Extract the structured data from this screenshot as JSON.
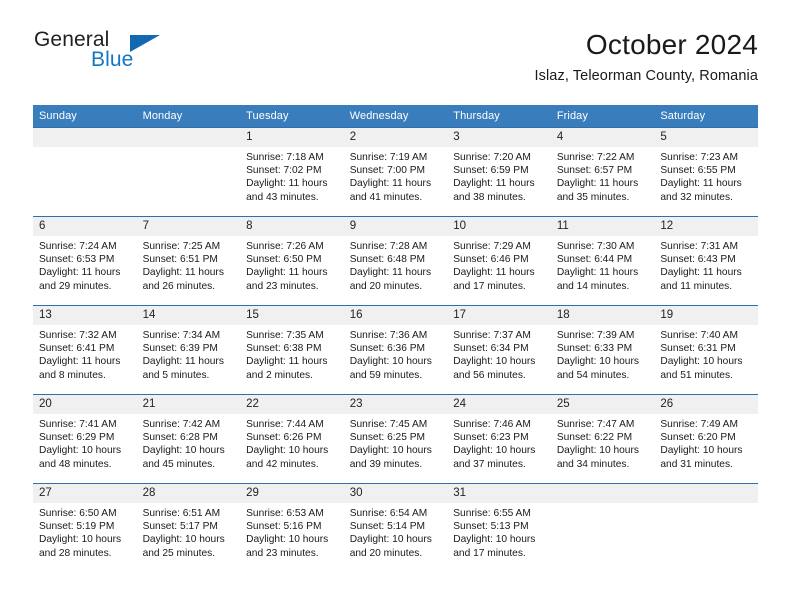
{
  "brand": {
    "name_part1": "General",
    "name_part2": "Blue"
  },
  "header": {
    "month_title": "October 2024",
    "location": "Islaz, Teleorman County, Romania"
  },
  "colors": {
    "header_blue": "#3a7dbd",
    "row_rule_blue": "#2f6fad",
    "daynum_band": "#f0f0f0",
    "logo_blue": "#1277c4"
  },
  "weekday_headers": [
    "Sunday",
    "Monday",
    "Tuesday",
    "Wednesday",
    "Thursday",
    "Friday",
    "Saturday"
  ],
  "weeks": [
    [
      {
        "day": "",
        "details": ""
      },
      {
        "day": "",
        "details": ""
      },
      {
        "day": "1",
        "details": "Sunrise: 7:18 AM\nSunset: 7:02 PM\nDaylight: 11 hours and 43 minutes."
      },
      {
        "day": "2",
        "details": "Sunrise: 7:19 AM\nSunset: 7:00 PM\nDaylight: 11 hours and 41 minutes."
      },
      {
        "day": "3",
        "details": "Sunrise: 7:20 AM\nSunset: 6:59 PM\nDaylight: 11 hours and 38 minutes."
      },
      {
        "day": "4",
        "details": "Sunrise: 7:22 AM\nSunset: 6:57 PM\nDaylight: 11 hours and 35 minutes."
      },
      {
        "day": "5",
        "details": "Sunrise: 7:23 AM\nSunset: 6:55 PM\nDaylight: 11 hours and 32 minutes."
      }
    ],
    [
      {
        "day": "6",
        "details": "Sunrise: 7:24 AM\nSunset: 6:53 PM\nDaylight: 11 hours and 29 minutes."
      },
      {
        "day": "7",
        "details": "Sunrise: 7:25 AM\nSunset: 6:51 PM\nDaylight: 11 hours and 26 minutes."
      },
      {
        "day": "8",
        "details": "Sunrise: 7:26 AM\nSunset: 6:50 PM\nDaylight: 11 hours and 23 minutes."
      },
      {
        "day": "9",
        "details": "Sunrise: 7:28 AM\nSunset: 6:48 PM\nDaylight: 11 hours and 20 minutes."
      },
      {
        "day": "10",
        "details": "Sunrise: 7:29 AM\nSunset: 6:46 PM\nDaylight: 11 hours and 17 minutes."
      },
      {
        "day": "11",
        "details": "Sunrise: 7:30 AM\nSunset: 6:44 PM\nDaylight: 11 hours and 14 minutes."
      },
      {
        "day": "12",
        "details": "Sunrise: 7:31 AM\nSunset: 6:43 PM\nDaylight: 11 hours and 11 minutes."
      }
    ],
    [
      {
        "day": "13",
        "details": "Sunrise: 7:32 AM\nSunset: 6:41 PM\nDaylight: 11 hours and 8 minutes."
      },
      {
        "day": "14",
        "details": "Sunrise: 7:34 AM\nSunset: 6:39 PM\nDaylight: 11 hours and 5 minutes."
      },
      {
        "day": "15",
        "details": "Sunrise: 7:35 AM\nSunset: 6:38 PM\nDaylight: 11 hours and 2 minutes."
      },
      {
        "day": "16",
        "details": "Sunrise: 7:36 AM\nSunset: 6:36 PM\nDaylight: 10 hours and 59 minutes."
      },
      {
        "day": "17",
        "details": "Sunrise: 7:37 AM\nSunset: 6:34 PM\nDaylight: 10 hours and 56 minutes."
      },
      {
        "day": "18",
        "details": "Sunrise: 7:39 AM\nSunset: 6:33 PM\nDaylight: 10 hours and 54 minutes."
      },
      {
        "day": "19",
        "details": "Sunrise: 7:40 AM\nSunset: 6:31 PM\nDaylight: 10 hours and 51 minutes."
      }
    ],
    [
      {
        "day": "20",
        "details": "Sunrise: 7:41 AM\nSunset: 6:29 PM\nDaylight: 10 hours and 48 minutes."
      },
      {
        "day": "21",
        "details": "Sunrise: 7:42 AM\nSunset: 6:28 PM\nDaylight: 10 hours and 45 minutes."
      },
      {
        "day": "22",
        "details": "Sunrise: 7:44 AM\nSunset: 6:26 PM\nDaylight: 10 hours and 42 minutes."
      },
      {
        "day": "23",
        "details": "Sunrise: 7:45 AM\nSunset: 6:25 PM\nDaylight: 10 hours and 39 minutes."
      },
      {
        "day": "24",
        "details": "Sunrise: 7:46 AM\nSunset: 6:23 PM\nDaylight: 10 hours and 37 minutes."
      },
      {
        "day": "25",
        "details": "Sunrise: 7:47 AM\nSunset: 6:22 PM\nDaylight: 10 hours and 34 minutes."
      },
      {
        "day": "26",
        "details": "Sunrise: 7:49 AM\nSunset: 6:20 PM\nDaylight: 10 hours and 31 minutes."
      }
    ],
    [
      {
        "day": "27",
        "details": "Sunrise: 6:50 AM\nSunset: 5:19 PM\nDaylight: 10 hours and 28 minutes."
      },
      {
        "day": "28",
        "details": "Sunrise: 6:51 AM\nSunset: 5:17 PM\nDaylight: 10 hours and 25 minutes."
      },
      {
        "day": "29",
        "details": "Sunrise: 6:53 AM\nSunset: 5:16 PM\nDaylight: 10 hours and 23 minutes."
      },
      {
        "day": "30",
        "details": "Sunrise: 6:54 AM\nSunset: 5:14 PM\nDaylight: 10 hours and 20 minutes."
      },
      {
        "day": "31",
        "details": "Sunrise: 6:55 AM\nSunset: 5:13 PM\nDaylight: 10 hours and 17 minutes."
      },
      {
        "day": "",
        "details": ""
      },
      {
        "day": "",
        "details": ""
      }
    ]
  ]
}
